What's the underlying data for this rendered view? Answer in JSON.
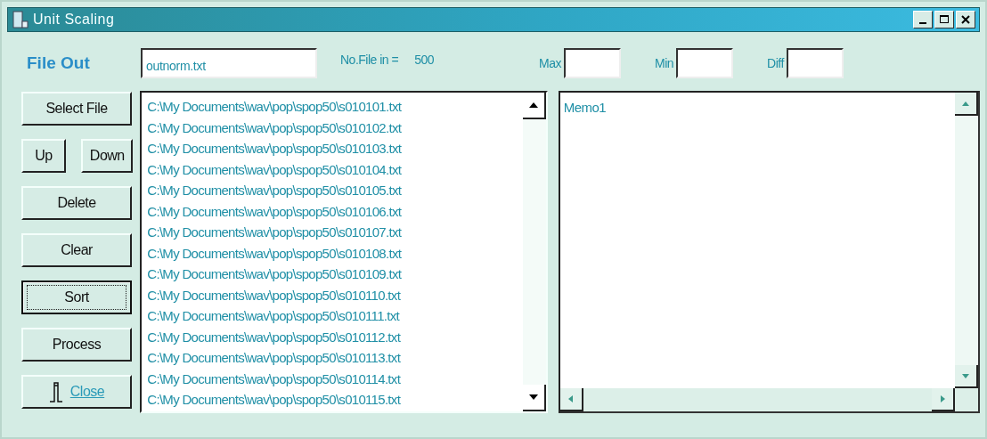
{
  "window": {
    "title": "Unit Scaling"
  },
  "header": {
    "file_out_label": "File Out",
    "file_out_value": "outnorm.txt",
    "count_label": "No.File in =",
    "count_value": "500",
    "fields": [
      {
        "label": "Max"
      },
      {
        "label": "Min"
      },
      {
        "label": "Diff"
      }
    ]
  },
  "buttons": [
    {
      "kind": "wide",
      "label": "Select File",
      "focused": false
    },
    {
      "kind": "pair",
      "items": [
        {
          "label": "Up",
          "focused": false
        },
        {
          "label": "Down",
          "focused": false
        }
      ]
    },
    {
      "kind": "wide",
      "label": "Delete",
      "focused": false
    },
    {
      "kind": "wide",
      "label": "Clear",
      "focused": false
    },
    {
      "kind": "wide",
      "label": "Sort",
      "focused": true
    },
    {
      "kind": "wide",
      "label": "Process",
      "focused": false
    },
    {
      "kind": "close",
      "label": "Close",
      "focused": false
    }
  ],
  "file_list": [
    "C:\\My Documents\\wav\\pop\\spop50\\s010101.txt",
    "C:\\My Documents\\wav\\pop\\spop50\\s010102.txt",
    "C:\\My Documents\\wav\\pop\\spop50\\s010103.txt",
    "C:\\My Documents\\wav\\pop\\spop50\\s010104.txt",
    "C:\\My Documents\\wav\\pop\\spop50\\s010105.txt",
    "C:\\My Documents\\wav\\pop\\spop50\\s010106.txt",
    "C:\\My Documents\\wav\\pop\\spop50\\s010107.txt",
    "C:\\My Documents\\wav\\pop\\spop50\\s010108.txt",
    "C:\\My Documents\\wav\\pop\\spop50\\s010109.txt",
    "C:\\My Documents\\wav\\pop\\spop50\\s010110.txt",
    "C:\\My Documents\\wav\\pop\\spop50\\s010111.txt",
    "C:\\My Documents\\wav\\pop\\spop50\\s010112.txt",
    "C:\\My Documents\\wav\\pop\\spop50\\s010113.txt",
    "C:\\My Documents\\wav\\pop\\spop50\\s010114.txt",
    "C:\\My Documents\\wav\\pop\\spop50\\s010115.txt"
  ],
  "memo": {
    "text": "Memo1"
  }
}
